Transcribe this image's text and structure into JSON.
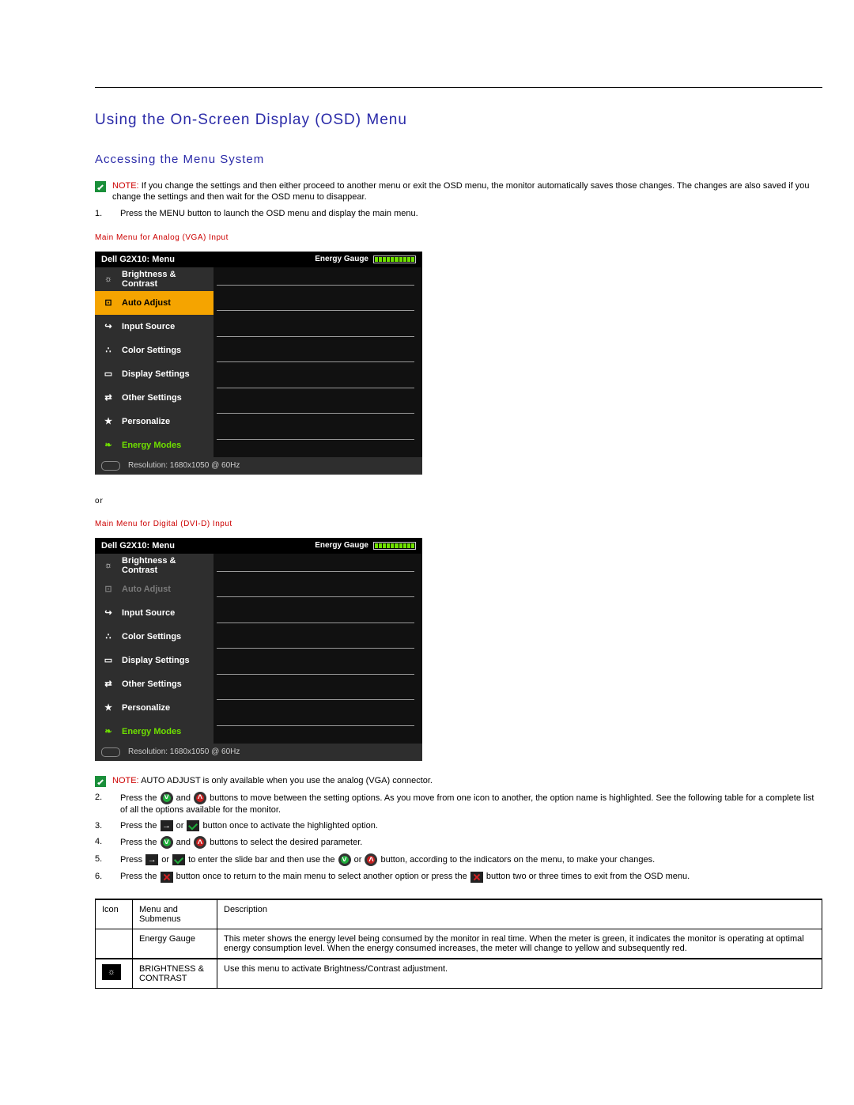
{
  "headings": {
    "h2": "Using the On-Screen Display (OSD) Menu",
    "h3": "Accessing the Menu System"
  },
  "note1": {
    "label": "NOTE:",
    "text": "If you change the settings and then either proceed to another menu or exit the OSD menu, the monitor automatically saves those changes. The changes are also saved if you change the settings and then wait for the OSD menu to disappear."
  },
  "step1": {
    "num": "1.",
    "text": "Press the MENU button to launch the OSD menu and display the main menu."
  },
  "caption_vga": "Main Menu for Analog (VGA) Input",
  "or_label": "or",
  "caption_dvi": "Main Menu for Digital (DVI-D) Input",
  "osd": {
    "title": "Dell G2X10: Menu",
    "gauge_label": "Energy Gauge",
    "items": [
      {
        "icon": "brightness-icon",
        "label": "Brightness & Contrast"
      },
      {
        "icon": "auto-adjust-icon",
        "label": "Auto Adjust"
      },
      {
        "icon": "input-source-icon",
        "label": "Input Source"
      },
      {
        "icon": "color-settings-icon",
        "label": "Color Settings"
      },
      {
        "icon": "display-settings-icon",
        "label": "Display Settings"
      },
      {
        "icon": "other-settings-icon",
        "label": "Other Settings"
      },
      {
        "icon": "personalize-icon",
        "label": "Personalize"
      },
      {
        "icon": "energy-modes-icon",
        "label": "Energy Modes"
      }
    ],
    "resolution": "Resolution: 1680x1050 @ 60Hz"
  },
  "note2": {
    "label": "NOTE:",
    "text": "AUTO ADJUST is only available when you use the analog (VGA) connector."
  },
  "steps": {
    "s2": {
      "num": "2.",
      "a": "Press the ",
      "b": " and ",
      "c": " buttons to move between the setting options. As you move from one icon to another, the option name is highlighted. See the following table for a complete list of all the options available for the monitor."
    },
    "s3": {
      "num": "3.",
      "a": "Press the ",
      "b": " or ",
      "c": " button once to activate the highlighted option."
    },
    "s4": {
      "num": "4.",
      "a": "Press the ",
      "b": " and ",
      "c": " buttons to select the desired parameter."
    },
    "s5": {
      "num": "5.",
      "a": "Press ",
      "b": " or ",
      "c": " to enter the slide bar and then use the ",
      "d": " or ",
      "e": " button, according to the indicators on the menu, to make your changes."
    },
    "s6": {
      "num": "6.",
      "a": "Press the ",
      "b": " button once to return to the main menu to select another option or press the ",
      "c": " button two or three times to exit from the OSD menu."
    }
  },
  "table": {
    "headers": {
      "icon": "Icon",
      "menu": "Menu and Submenus",
      "desc": "Description"
    },
    "rows": [
      {
        "icon": "",
        "menu": "Energy Gauge",
        "desc": "This meter shows the energy level being consumed by the monitor in real time. When the meter is green, it indicates the monitor is operating at optimal energy consumption level. When the energy consumed increases, the meter will change to yellow and subsequently red."
      },
      {
        "icon": "brightness",
        "menu": "BRIGHTNESS & CONTRAST",
        "desc": "Use this menu to activate Brightness/Contrast adjustment."
      }
    ]
  },
  "icons": {
    "brightness-icon": "☼",
    "auto-adjust-icon": "▣",
    "input-source-icon": "⮔",
    "color-settings-icon": "∴",
    "display-settings-icon": "▭",
    "other-settings-icon": "⇄",
    "personalize-icon": "★",
    "energy-modes-icon": "❧"
  }
}
